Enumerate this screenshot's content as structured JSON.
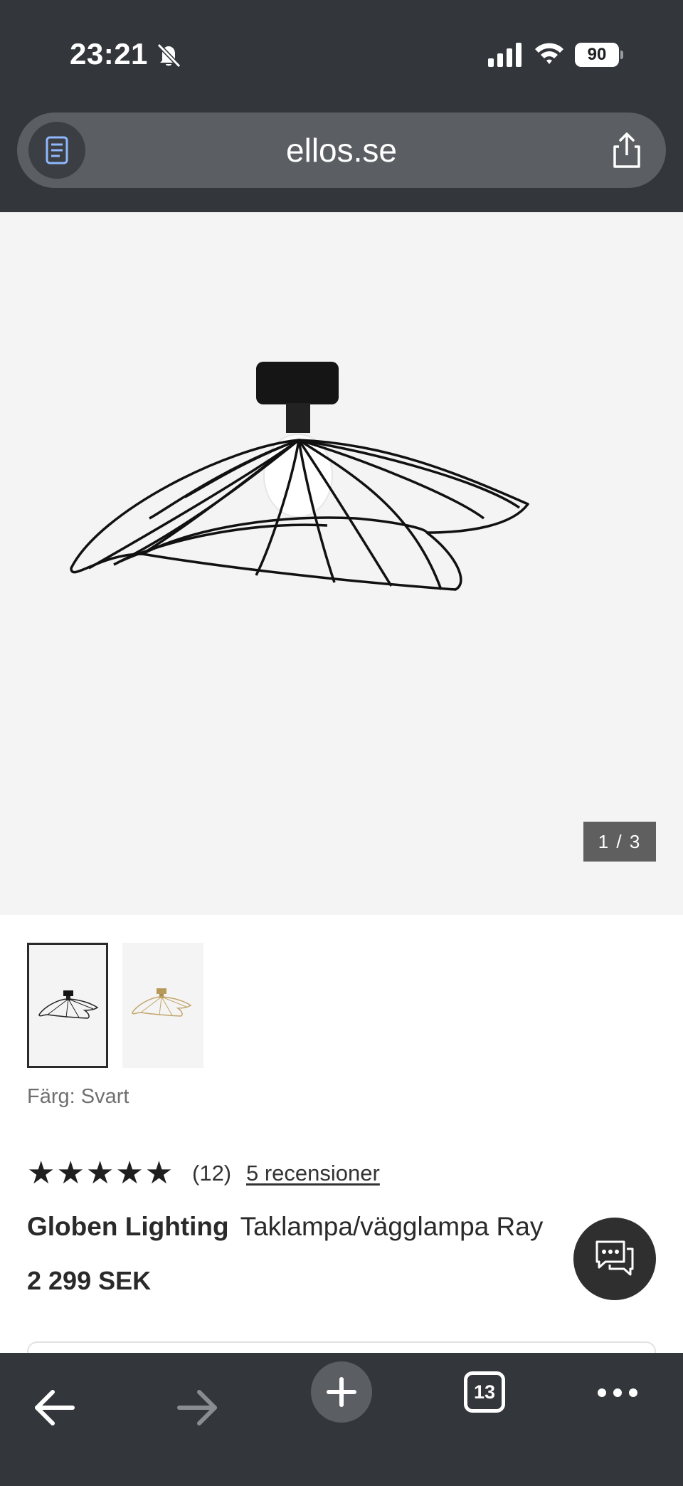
{
  "status_bar": {
    "time": "23:21",
    "battery": "90",
    "icons": [
      "bell-slash-icon",
      "signal-icon",
      "wifi-icon",
      "battery-icon"
    ]
  },
  "address_bar": {
    "url": "ellos.se",
    "left_icon": "reader-icon",
    "right_icon": "share-icon"
  },
  "gallery": {
    "counter": "1 / 3",
    "thumbnails": [
      {
        "name": "black-lamp-thumbnail",
        "selected": true
      },
      {
        "name": "brass-lamp-thumbnail",
        "selected": false
      }
    ]
  },
  "product": {
    "color_label": "Färg: Svart",
    "stars": "★★★★★",
    "rating_count": "(12)",
    "reviews_link": "5 recensioner",
    "brand": "Globen Lighting",
    "name": "Taklampa/vägglampa Ray",
    "price": "2 299 SEK"
  },
  "chat": {
    "icon": "chat-icon"
  },
  "toolbar": {
    "tabs_count": "13",
    "icons": [
      "back-arrow-icon",
      "forward-arrow-icon",
      "plus-icon",
      "tabs-icon",
      "more-icon"
    ]
  },
  "colors": {
    "chrome": "#33363a",
    "url_pill": "#5b5f63",
    "gallery_bg": "#f4f4f4",
    "text": "#2a2a2a"
  }
}
